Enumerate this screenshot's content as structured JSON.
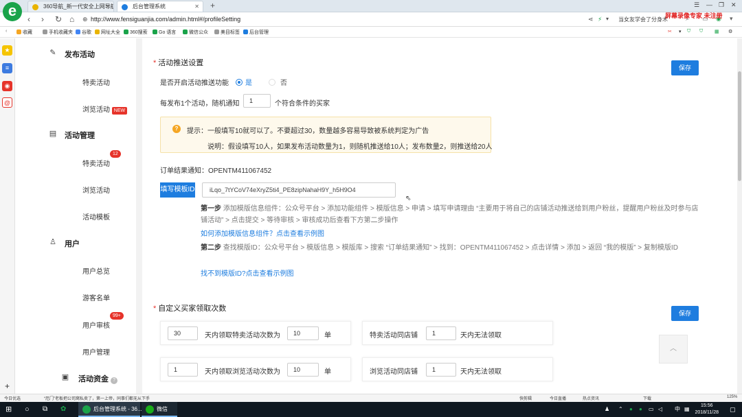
{
  "browser": {
    "tabs": [
      {
        "label": "360导航_新一代安全上网导航",
        "active": false
      },
      {
        "label": "后台管理系统",
        "active": true
      }
    ],
    "recording_watermark": "屏幕录像专家 未注册",
    "url": "http://www.fensiguanjia.com/admin.html#/profileSetting",
    "search_text": "当女友学会了分身术",
    "bookmarks": [
      "收藏",
      "手机收藏夹",
      "谷歌",
      "网址大全",
      "360搜索",
      "Go 语言",
      "微信公众",
      "美目标签",
      "后台管理"
    ],
    "zoom": "125%"
  },
  "colors": {
    "primary": "#1e7ddf",
    "danger": "#e6332a",
    "warning": "#f5a623"
  },
  "menu": {
    "groups": [
      {
        "title": "发布活动",
        "icon": "edit-icon",
        "items": [
          {
            "label": "特卖活动",
            "badge": ""
          },
          {
            "label": "浏览活动",
            "badge": "NEW"
          }
        ]
      },
      {
        "title": "活动管理",
        "icon": "clipboard-icon",
        "items": [
          {
            "label": "特卖活动",
            "badge": "12"
          },
          {
            "label": "浏览活动",
            "badge": ""
          },
          {
            "label": "活动模板",
            "badge": ""
          }
        ]
      },
      {
        "title": "用户",
        "icon": "user-icon",
        "items": [
          {
            "label": "用户总览",
            "badge": ""
          },
          {
            "label": "游客名单",
            "badge": ""
          },
          {
            "label": "用户审核",
            "badge": "99+"
          },
          {
            "label": "用户管理",
            "badge": ""
          }
        ]
      },
      {
        "title": "活动资金",
        "icon": "wallet-icon",
        "items": []
      }
    ]
  },
  "push": {
    "title": "活动推送设置",
    "save": "保存",
    "enable_label": "是否开启活动推送功能",
    "yes": "是",
    "no": "否",
    "selected": "是",
    "notify_prefix": "每发布1个活动，随机通知",
    "notify_value": "1",
    "notify_suffix": "个符合条件的买家",
    "tip_line1": "提示：一般填写10就可以了。不要超过30，数量越多容易导致被系统判定为广告",
    "tip_line2": "说明：假设填写10人，如果发布活动数量为1，则随机推送给10人；发布数量2，则推送给20人",
    "order_notice": "订单结果通知：OPENTM411067452",
    "template_label": "填写模板ID",
    "template_value": "iLqo_7tYCoV74eXryZ5ti4_PE8zipNahaH9Y_h5H9O4",
    "step1_title": "第一步",
    "step1_text": "添加模版信息组件：公众号平台 > 添加功能组件 > 模版信息 > 申请 > 填写申请理由 “主要用于将自己的店铺活动推送给到用户粉丝，提醒用户粉丝及时参与店铺活动” > 点击提交 > 等待审核 > 审核成功后查看下方第二步操作",
    "step1_link": "如何添加模版信息组件？点击查看示例图",
    "step2_title": "第二步",
    "step2_text": "查找模版ID：公众号平台 > 模版信息 > 模版库 > 搜索 “订单结果通知” > 找到：OPENTM411067452 > 点击详情 > 添加 > 返回 “我的模版” > 复制模版ID",
    "step2_link": "找不到模版ID?点击查看示例图"
  },
  "limits": {
    "title": "自定义买家领取次数",
    "save": "保存",
    "rows": [
      {
        "days": "30",
        "middle": "天内领取特卖活动次数为",
        "count": "10",
        "unit": "单",
        "shop_label": "特卖活动同店铺",
        "shop_days": "1",
        "shop_suffix": "天内无法领取"
      },
      {
        "days": "1",
        "middle": "天内领取浏览活动次数为",
        "count": "10",
        "unit": "单",
        "shop_label": "浏览活动同店铺",
        "shop_days": "1",
        "shop_suffix": "天内无法领取"
      }
    ]
  },
  "statusbar": {
    "left": "今日优选",
    "news": "“厄门”老板把公司窝私卖了，第一上帝，同事们都无从下手",
    "items": [
      "快剪辑",
      "今日直播",
      "热点资讯",
      "下载"
    ]
  },
  "taskbar": {
    "apps": [
      "后台管理系统 - 36...",
      "微信"
    ],
    "time": "15:56",
    "date": "2018/11/28",
    "lang": "中"
  }
}
